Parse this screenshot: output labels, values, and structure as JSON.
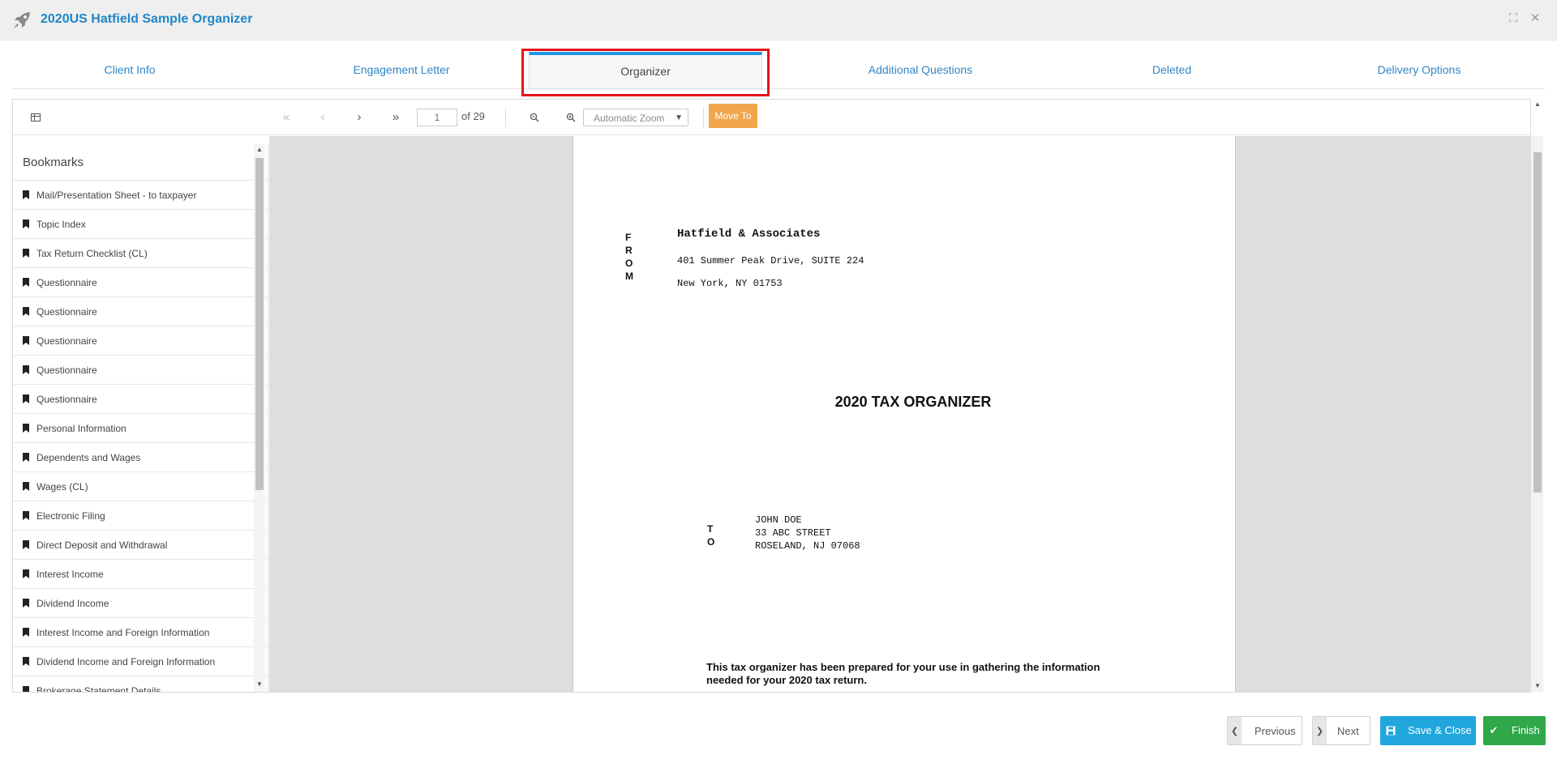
{
  "window": {
    "title": "2020US Hatfield Sample Organizer"
  },
  "tabs": [
    {
      "label": "Client Info"
    },
    {
      "label": "Engagement Letter"
    },
    {
      "label": "Organizer"
    },
    {
      "label": "Additional Questions"
    },
    {
      "label": "Deleted"
    },
    {
      "label": "Delivery Options"
    }
  ],
  "toolbar": {
    "first_glyph": "«",
    "prev_glyph": "‹",
    "next_glyph": "›",
    "last_glyph": "»",
    "page_value": "1",
    "page_of": "of 29",
    "zoom_value": "Automatic Zoom",
    "move_to_label": "Move To"
  },
  "bookmarks": {
    "header": "Bookmarks",
    "items": [
      "Mail/Presentation Sheet - to taxpayer",
      "Topic Index",
      "Tax Return Checklist (CL)",
      "Questionnaire",
      "Questionnaire",
      "Questionnaire",
      "Questionnaire",
      "Questionnaire",
      "Personal Information",
      "Dependents and Wages",
      "Wages (CL)",
      "Electronic Filing",
      "Direct Deposit and Withdrawal",
      "Interest Income",
      "Dividend Income",
      "Interest Income and Foreign Information",
      "Dividend Income and Foreign Information",
      "Brokerage Statement Details"
    ]
  },
  "document": {
    "from_letters": [
      "F",
      "R",
      "O",
      "M"
    ],
    "firm_name": "Hatfield & Associates",
    "firm_address1": "401 Summer Peak Drive, SUITE 224",
    "firm_address2": "New York, NY  01753",
    "title": "2020 TAX ORGANIZER",
    "to_letters": [
      "T",
      "O"
    ],
    "recipient_lines": [
      "JOHN DOE",
      "33 ABC STREET",
      "ROSELAND, NJ  07068"
    ],
    "intro_line1": "This tax organizer has been prepared for your use in gathering the information",
    "intro_line2": "needed for your 2020 tax return."
  },
  "footer": {
    "previous_label": "Previous",
    "next_label": "Next",
    "save_close_label": "Save & Close",
    "finish_label": "Finish"
  },
  "colors": {
    "brand_blue": "#1e86c8",
    "active_tab_bar": "#1e9ae5",
    "highlight_red": "#e3141b",
    "move_to_orange": "#f1a64b",
    "save_blue": "#21a6de",
    "finish_green": "#2fa84a"
  }
}
